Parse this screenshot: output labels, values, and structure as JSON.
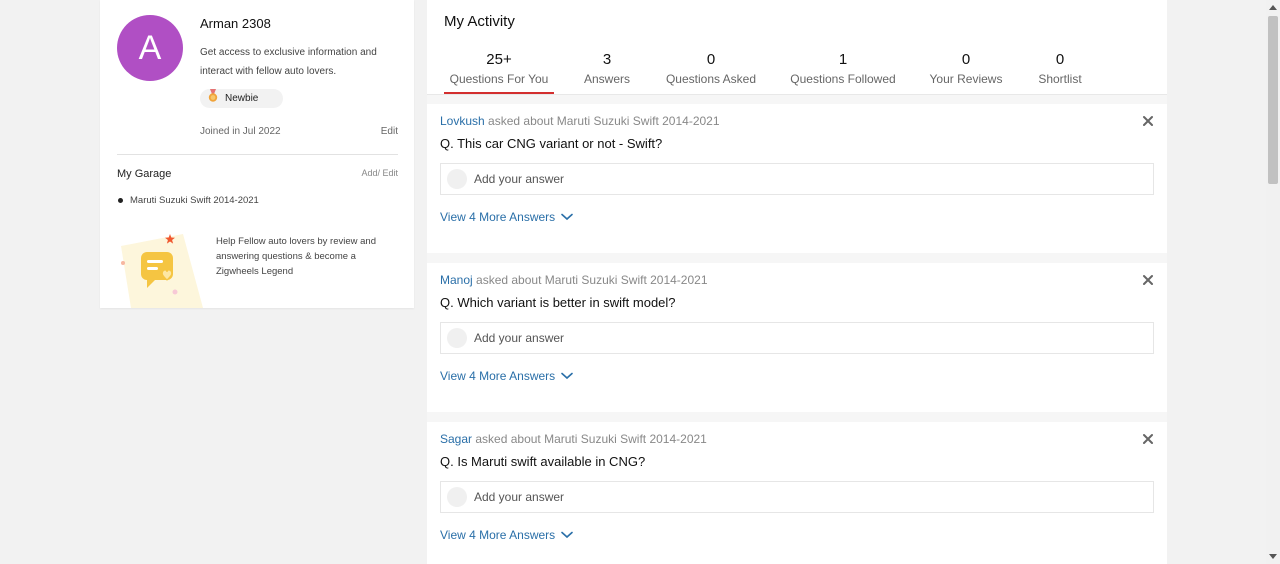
{
  "profile": {
    "avatar_letter": "A",
    "avatar_color": "#b04fc4",
    "name": "Arman 2308",
    "description": "Get access to exclusive information and interact with fellow auto lovers.",
    "badge_icon": "medal-icon",
    "badge_label": "Newbie",
    "joined": "Joined in Jul 2022",
    "edit_label": "Edit"
  },
  "garage": {
    "title": "My Garage",
    "edit_label": "Add/ Edit",
    "items": [
      "Maruti Suzuki Swift 2014-2021"
    ]
  },
  "promo": {
    "text": "Help Fellow auto lovers by review and answering questions & become a Zigwheels Legend",
    "icon": "chat-heart-icon"
  },
  "activity": {
    "title": "My Activity",
    "accent_color": "#d32f2f",
    "link_color": "#2a6fa8",
    "tabs": [
      {
        "count": "25+",
        "label": "Questions For You",
        "active": true
      },
      {
        "count": "3",
        "label": "Answers",
        "active": false
      },
      {
        "count": "0",
        "label": "Questions Asked",
        "active": false
      },
      {
        "count": "1",
        "label": "Questions Followed",
        "active": false
      },
      {
        "count": "0",
        "label": "Your Reviews",
        "active": false
      },
      {
        "count": "0",
        "label": "Shortlist",
        "active": false
      }
    ],
    "questions": [
      {
        "author": "Lovkush",
        "about": "asked about Maruti Suzuki Swift 2014-2021",
        "question": "Q. This car CNG variant or not - Swift?",
        "answer_placeholder": "Add your answer",
        "more_answers": "View 4 More Answers"
      },
      {
        "author": "Manoj",
        "about": "asked about Maruti Suzuki Swift 2014-2021",
        "question": "Q. Which variant is better in swift model?",
        "answer_placeholder": "Add your answer",
        "more_answers": "View 4 More Answers"
      },
      {
        "author": "Sagar",
        "about": "asked about Maruti Suzuki Swift 2014-2021",
        "question": "Q. Is Maruti swift available in CNG?",
        "answer_placeholder": "Add your answer",
        "more_answers": "View 4 More Answers"
      }
    ]
  }
}
